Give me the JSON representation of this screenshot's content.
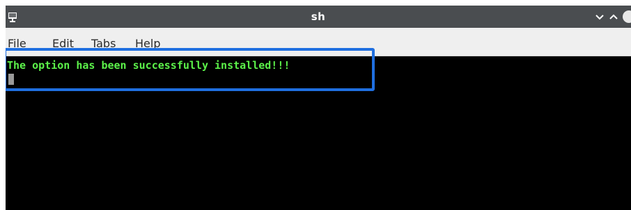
{
  "window": {
    "title": "sh"
  },
  "menu": {
    "items": [
      "File",
      "Edit",
      "Tabs",
      "Help"
    ]
  },
  "terminal": {
    "lines": [
      "The option has been successfully installed!!!"
    ],
    "text_color": "#5cf24a",
    "background": "#000000",
    "cursor_color": "#9a9a9a"
  },
  "annotation": {
    "highlight_color": "#1f6fe0"
  },
  "icons": {
    "app": "terminal-icon",
    "minimize": "chevron-down-icon",
    "maximize": "chevron-up-icon",
    "close": "circle-button-icon"
  },
  "colors": {
    "titlebar": "#4a4d50",
    "menubar": "#efefef"
  }
}
